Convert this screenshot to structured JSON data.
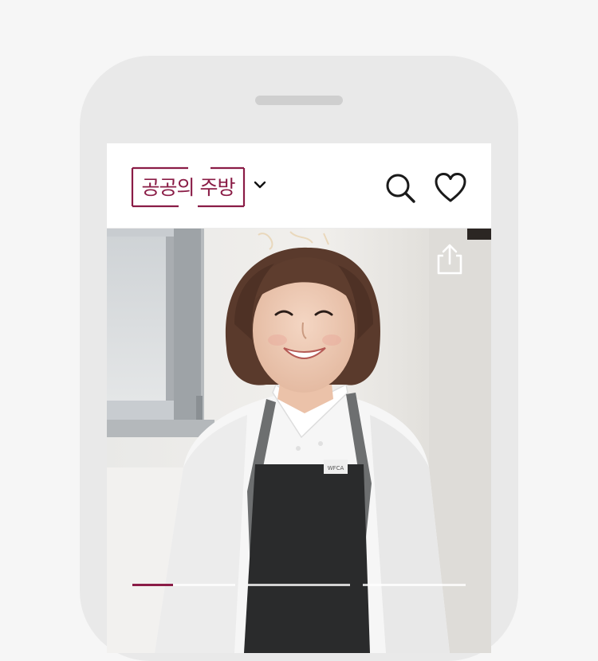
{
  "header": {
    "logo_text": "공공의 주방",
    "brand_color": "#8a1c46"
  },
  "icons": {
    "menu_toggle": "chevron-down-icon",
    "search": "search-icon",
    "favorite": "heart-icon",
    "share": "share-icon"
  },
  "hero": {
    "apron_label": "WFCA",
    "slides_total": 3,
    "current_slide": 1,
    "current_slide_progress": 0.4
  },
  "colors": {
    "accent": "#8a1c46",
    "phone_frame": "#e9e9e9",
    "background": "#f6f6f6"
  }
}
